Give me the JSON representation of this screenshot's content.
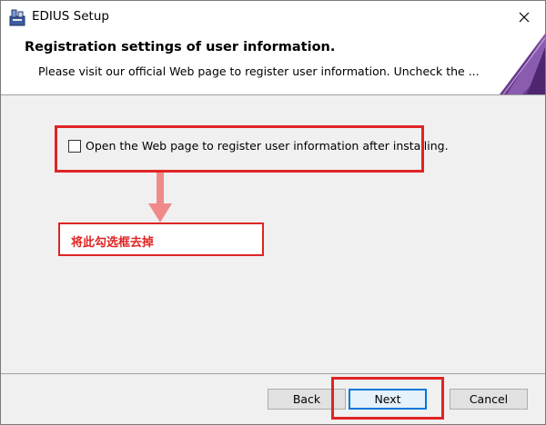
{
  "window": {
    "title": "EDIUS Setup"
  },
  "header": {
    "title": "Registration settings of user information.",
    "description": "Please visit our official Web page to register user information. Uncheck the ..."
  },
  "option": {
    "label": "Open the Web page to register user information after installing.",
    "checked": false
  },
  "annotation": {
    "text": "将此勾选框去掉",
    "color": "#e02424"
  },
  "buttons": {
    "back": "Back",
    "next": "Next",
    "cancel": "Cancel"
  },
  "icons": {
    "app": "installer-icon",
    "close": "close-icon",
    "arrow": "arrow-down-icon",
    "banner": "purple-banner-graphic"
  },
  "colors": {
    "highlight": "#e02424",
    "default_button_border": "#0078d7",
    "banner": "#6a3a8e"
  }
}
